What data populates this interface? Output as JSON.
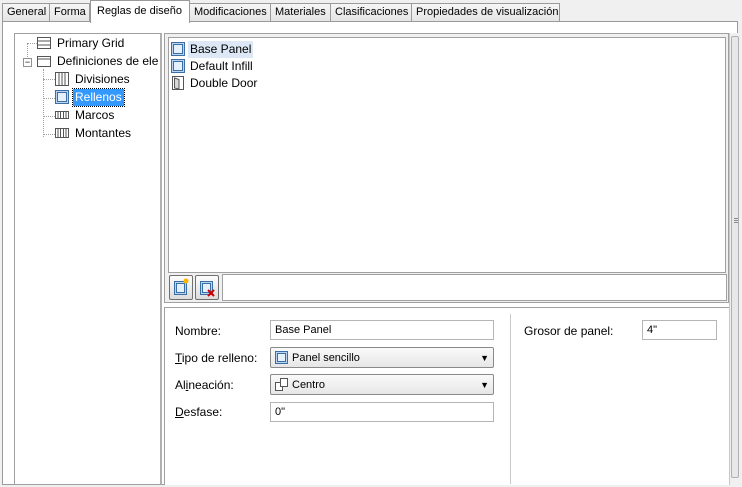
{
  "tabs": [
    {
      "label": "General"
    },
    {
      "label": "Forma"
    },
    {
      "label": "Reglas de diseño"
    },
    {
      "label": "Modificaciones"
    },
    {
      "label": "Materiales"
    },
    {
      "label": "Clasificaciones"
    },
    {
      "label": "Propiedades de visualización"
    }
  ],
  "active_tab": "Reglas de diseño",
  "tree": {
    "root1": {
      "label": "Primary Grid",
      "icon": "grid-icon"
    },
    "root2": {
      "label": "Definiciones de ele",
      "icon": "folder-icon",
      "expander": "−"
    },
    "children": [
      {
        "label": "Divisiones",
        "icon": "divisions-icon"
      },
      {
        "label": "Rellenos",
        "icon": "infill-icon",
        "selected": true
      },
      {
        "label": "Marcos",
        "icon": "frames-icon"
      },
      {
        "label": "Montantes",
        "icon": "mullions-icon"
      }
    ]
  },
  "list": {
    "items": [
      {
        "label": "Base Panel",
        "icon": "panel-icon",
        "selected": true
      },
      {
        "label": "Default Infill",
        "icon": "panel-icon"
      },
      {
        "label": "Double Door",
        "icon": "door-icon"
      }
    ]
  },
  "props": {
    "nombre_label": "Nombre:",
    "nombre_value": "Base Panel",
    "tipo_label_u": "T",
    "tipo_label_rest": "ipo de relleno:",
    "tipo_value": "Panel sencillo",
    "alineacion_label_pre": "Al",
    "alineacion_label_u": "i",
    "alineacion_label_rest": "neación:",
    "alineacion_value": "Centro",
    "desfase_label_u": "D",
    "desfase_label_rest": "esfase:",
    "desfase_value": "0\"",
    "grosor_label": "Grosor de panel:",
    "grosor_value": "4\""
  },
  "colors": {
    "selection": "#3399ff",
    "list_selection": "#dce8f5"
  }
}
